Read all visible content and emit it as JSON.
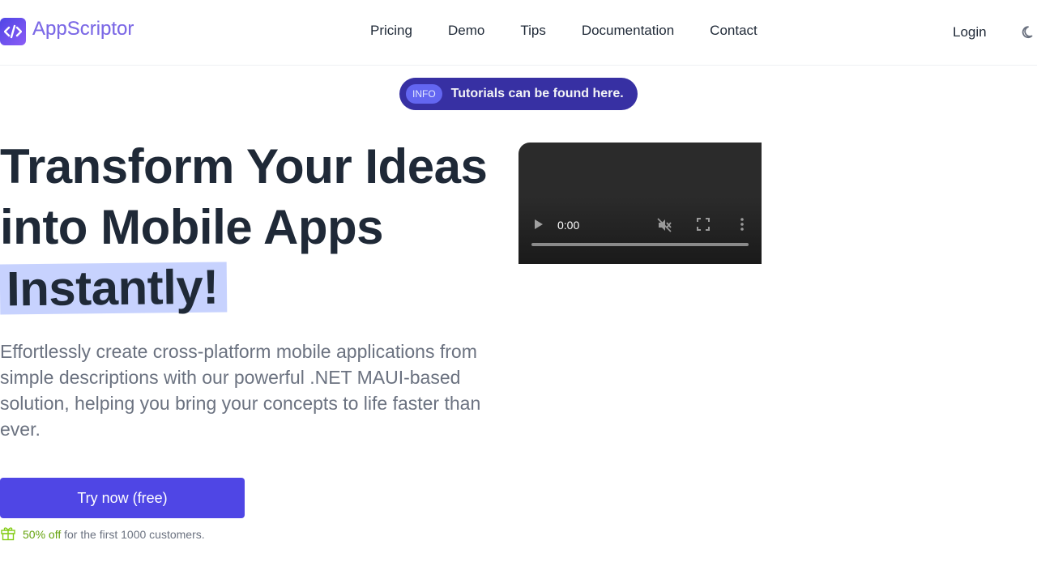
{
  "brand": {
    "name": "AppScriptor",
    "icon": "code-icon"
  },
  "nav": {
    "items": [
      {
        "label": "Pricing"
      },
      {
        "label": "Demo"
      },
      {
        "label": "Tips"
      },
      {
        "label": "Documentation"
      },
      {
        "label": "Contact"
      }
    ],
    "login_label": "Login",
    "theme_icon": "moon-icon"
  },
  "banner": {
    "badge": "INFO",
    "text": "Tutorials can be found here."
  },
  "hero": {
    "title_line1": "Transform Your Ideas",
    "title_line2": "into Mobile Apps",
    "title_highlight": "Instantly!",
    "description": "Effortlessly create cross-platform mobile applications from simple descriptions with our powerful .NET MAUI-based solution, helping you bring your concepts to life faster than ever.",
    "cta_label": "Try now (free)",
    "promo_highlight": "50% off",
    "promo_rest": "for the first 1000 customers.",
    "promo_icon": "gift-icon"
  },
  "video": {
    "current_time": "0:00",
    "progress": 0,
    "muted": true,
    "icons": [
      "play-icon",
      "volume-muted-icon",
      "fullscreen-icon",
      "more-vertical-icon"
    ]
  },
  "colors": {
    "accent": "#4f46e5",
    "banner_bg": "#3730a3",
    "highlight_bg": "#c7d2fe",
    "promo_green": "#65a30d"
  }
}
